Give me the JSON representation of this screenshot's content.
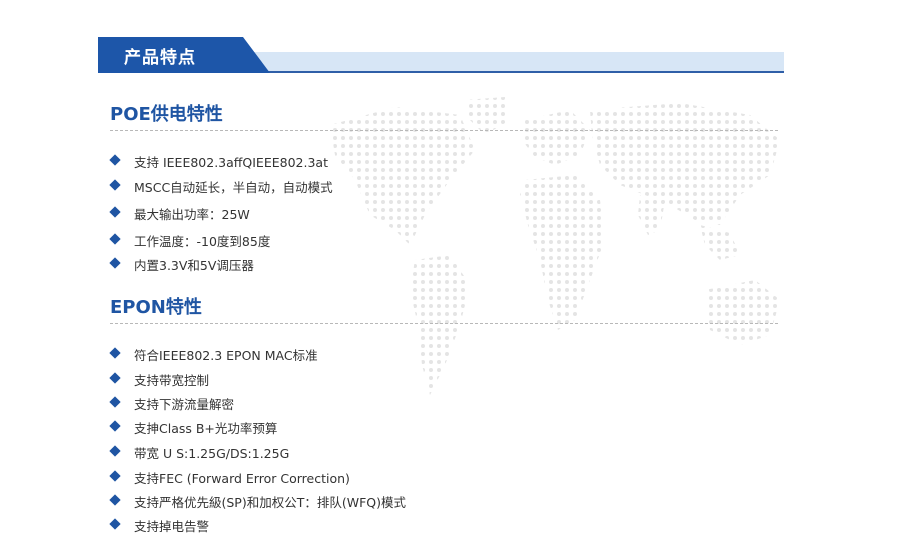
{
  "header": {
    "title": "产品特点"
  },
  "sections": [
    {
      "title": "POE供电特性",
      "items": [
        "支持 IEEE802.3affQIEEE802.3at",
        "MSCC自动延长，半自动，自动模式",
        "最大输出功率：25W",
        "工作温度：-10度到85度",
        "内置3.3V和5V调压器"
      ]
    },
    {
      "title": "EPON特性",
      "items": [
        "符合IEEE802.3 EPON MAC标准",
        "支持带宽控制",
        "支持下游流量解密",
        "支抻Class B+光功率预算",
        "带宽 U S:1.25G/DS:1.25G",
        "支持FEC (Forward Error Correction)",
        "支持严格优先級(SP)和加权公T：排队(WFQ)模式",
        "支持掉电告警"
      ]
    }
  ],
  "colors": {
    "accent": "#1f55a3",
    "band": "#d7e6f6"
  },
  "icons": {
    "bullet": "diamond-bullet-icon",
    "background": "world-map-dots"
  }
}
